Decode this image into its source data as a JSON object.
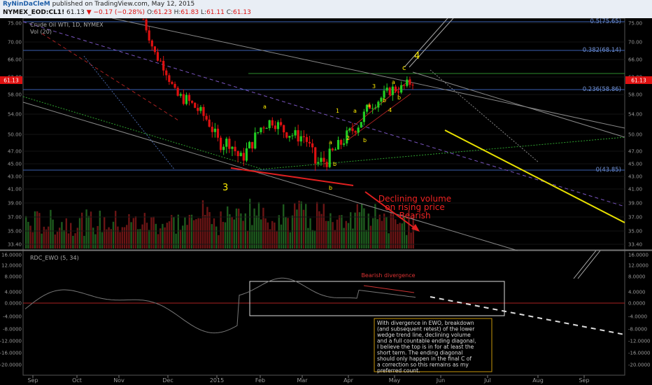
{
  "header": {
    "author": "RyNinDaCleM",
    "published": "published on TradingView.com, May 12, 2015",
    "symbol": "NYMEX_EOD:CL1!",
    "last": "61.13",
    "change": "▼ −0.17 (−0.28%)",
    "open_label": "O:",
    "open": "61.23",
    "high_label": "H:",
    "high": "61.83",
    "low_label": "L:",
    "low": "61.11",
    "close_label": "C:",
    "close": "61.13"
  },
  "main": {
    "instrument": "Crude Oil WTI, 1D, NYMEX",
    "volume_label": "Vol (20)",
    "price_badge": "61.13",
    "price_ticks": [
      "75.00",
      "70.00",
      "66.00",
      "62.00",
      "58.00",
      "54.00",
      "50.00",
      "47.00",
      "45.00",
      "43.00",
      "41.00",
      "39.00",
      "37.00",
      "35.00",
      "33.40"
    ],
    "fib_labels": [
      "0.5(75.65)",
      "0.382(68.14)",
      "0.236(58.86)",
      "0(43.85)"
    ],
    "wave_labels": [
      "3",
      "4",
      "c",
      "a",
      "a",
      "b",
      "b",
      "1",
      "2",
      "3",
      "4",
      "a",
      "b",
      "b",
      "a",
      "b",
      "a"
    ],
    "annotation_volume": [
      "Declining volume",
      "on rising price",
      "Bearish"
    ]
  },
  "indicator": {
    "label": "RDC_EWO (5, 34)",
    "ticks": [
      "16.0000",
      "12.0000",
      "8.0000",
      "4.0000",
      "0.0000",
      "-4.0000",
      "-8.0000",
      "-12.0000",
      "-16.0000",
      "-20.0000"
    ],
    "divergence_label": "Bearish divergence",
    "note": [
      "With divergence in EWO, breakdown",
      "(and subsequent retest) of the lower",
      "wedge trend line, declining volume",
      "and a full countable ending diagonal,",
      "I believe the top is in for at least the",
      "short term. The ending diagonal",
      "should only happen in the final C of",
      "a correction so this remains as my",
      "preferred count."
    ]
  },
  "time_axis": [
    "Sep",
    "Oct",
    "Nov",
    "Dec",
    "2015",
    "Feb",
    "Mar",
    "Apr",
    "May",
    "Jun",
    "Jul",
    "Aug",
    "Sep"
  ],
  "colors": {
    "up": "#22cc22",
    "down": "#dd1111",
    "fib": "#3a5fb0",
    "wave": "#ffee00",
    "annot": "#ee2222",
    "diag": "#ffee00"
  },
  "chart_data": {
    "type": "candlestick",
    "title": "Crude Oil WTI, 1D, NYMEX",
    "x": [
      "2014-11-17",
      "2014-11-24",
      "2014-12-01",
      "2014-12-08",
      "2014-12-15",
      "2014-12-22",
      "2014-12-29",
      "2015-01-05",
      "2015-01-12",
      "2015-01-19",
      "2015-01-26",
      "2015-02-02",
      "2015-02-09",
      "2015-02-16",
      "2015-02-23",
      "2015-03-02",
      "2015-03-09",
      "2015-03-16",
      "2015-03-23",
      "2015-03-30",
      "2015-04-06",
      "2015-04-13",
      "2015-04-20",
      "2015-04-27",
      "2015-05-04",
      "2015-05-11"
    ],
    "close": [
      76.0,
      67.5,
      64.2,
      57.8,
      56.9,
      55.0,
      52.7,
      48.4,
      48.7,
      45.6,
      48.2,
      51.7,
      52.8,
      50.8,
      49.8,
      49.6,
      45.0,
      45.6,
      47.6,
      50.0,
      52.1,
      55.8,
      57.2,
      59.2,
      59.4,
      61.13
    ],
    "series": [
      {
        "name": "Vol (20)"
      }
    ],
    "ylim": [
      33.4,
      76.5
    ],
    "fib_levels": [
      75.65,
      68.14,
      58.86,
      43.85
    ],
    "indicator_range": [
      -20,
      16
    ]
  }
}
